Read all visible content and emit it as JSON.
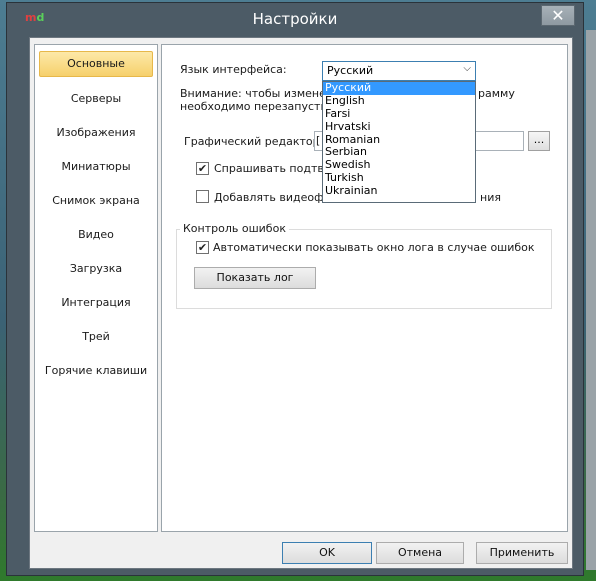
{
  "window": {
    "app_icon": {
      "m": "m",
      "d": "d"
    },
    "title": "Настройки",
    "close_symbol": "✕"
  },
  "sidebar": {
    "items": [
      {
        "label": "Основные",
        "selected": true
      },
      {
        "label": "Серверы"
      },
      {
        "label": "Изображения"
      },
      {
        "label": "Миниатюры"
      },
      {
        "label": "Снимок экрана"
      },
      {
        "label": "Видео"
      },
      {
        "label": "Загрузка"
      },
      {
        "label": "Интеграция"
      },
      {
        "label": "Трей"
      },
      {
        "label": "Горячие клавиши"
      }
    ]
  },
  "main": {
    "language_label": "Язык интерфейса:",
    "language_selected": "Русский",
    "language_options": [
      "Русский",
      "English",
      "Farsi",
      "Hrvatski",
      "Romanian",
      "Serbian",
      "Swedish",
      "Turkish",
      "Ukrainian"
    ],
    "warning_line1_left": "Внимание: чтобы изменения",
    "warning_line1_right": "рамму",
    "warning_line2": "необходимо перезапустить.",
    "editor_label": "Графический редактор:",
    "editor_value_prefix": "[",
    "browse_label": "...",
    "confirm_checkbox_label": "Спрашивать подтверж",
    "confirm_checked": true,
    "video_checkbox_label_left": "Добавлять видеофайл",
    "video_checkbox_label_right": "ния",
    "video_checked": false,
    "error_group_title": "Контроль ошибок",
    "auto_log_label": "Автоматически показывать окно лога в случае ошибок",
    "auto_log_checked": true,
    "show_log_button": "Показать лог"
  },
  "footer": {
    "ok_label": "OK",
    "cancel_label": "Отмена",
    "apply_label": "Применить"
  },
  "colors": {
    "selection": "#3399ff",
    "sidebar_selected": "#f6d06c"
  }
}
